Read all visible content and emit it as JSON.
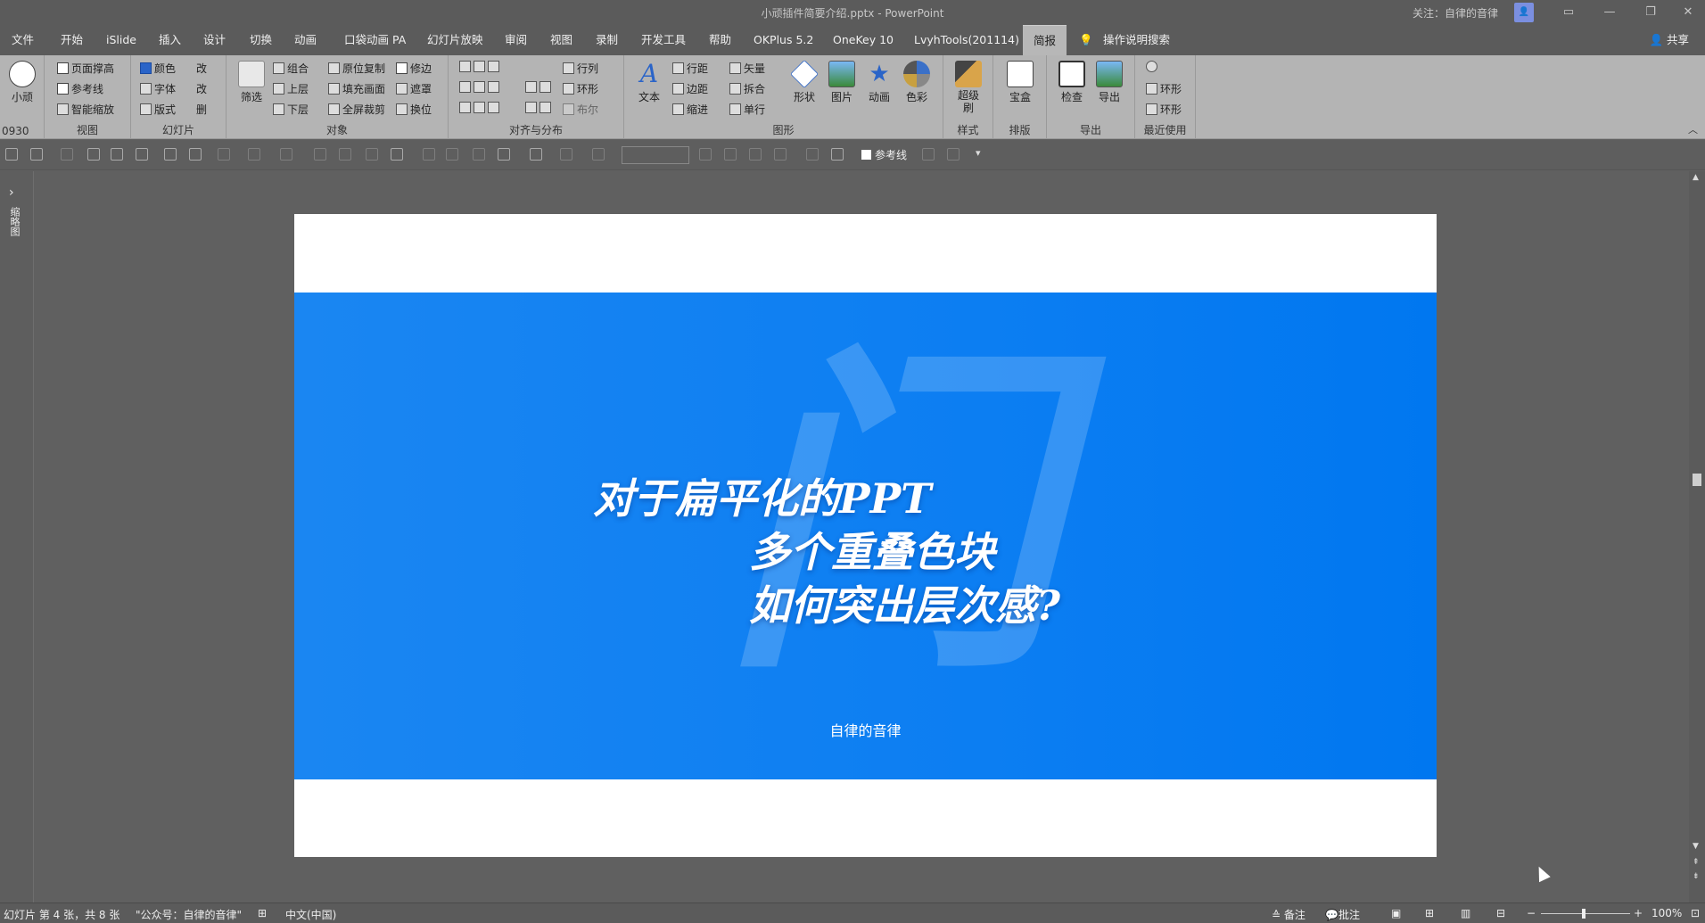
{
  "window": {
    "title": "小顽插件简要介绍.pptx  -  PowerPoint",
    "follow_text": "关注：自律的音律",
    "controls": [
      "▭",
      "—",
      "❐",
      "✕"
    ]
  },
  "tabs": [
    "文件",
    "开始",
    "iSlide",
    "插入",
    "设计",
    "切换",
    "动画",
    "口袋动画 PA",
    "幻灯片放映",
    "审阅",
    "视图",
    "录制",
    "开发工具",
    "帮助",
    "OKPlus 5.2",
    "OneKey 10",
    "LvyhTools(201114)",
    "简报"
  ],
  "tell_me": "操作说明搜索",
  "share": "共享",
  "ribbon": {
    "user": {
      "label": "小顽",
      "sub": "0930"
    },
    "view": {
      "items": [
        "页面撑高",
        "参考线",
        "智能缩放"
      ],
      "label": "视图"
    },
    "slide": {
      "items": [
        "颜色",
        "字体",
        "版式"
      ],
      "right": [
        "改",
        "改",
        "删"
      ],
      "label": "幻灯片"
    },
    "object": {
      "filter": "筛选",
      "col1": [
        "组合",
        "上层",
        "下层"
      ],
      "col2": [
        "原位复制",
        "填充画面",
        "全屏裁剪"
      ],
      "col3": [
        "修边",
        "遮罩",
        "换位"
      ],
      "label": "对象"
    },
    "align": {
      "items": [
        "行列",
        "环形",
        "布尔"
      ],
      "label": "对齐与分布"
    },
    "shape": {
      "text": "文本",
      "col1": [
        "行距",
        "边距",
        "缩进"
      ],
      "col2": [
        "矢量",
        "拆合",
        "单行"
      ],
      "big": [
        "形状",
        "图片",
        "动画",
        "色彩"
      ],
      "label": "图形"
    },
    "style": {
      "label": "样式",
      "btn": "超级刷"
    },
    "layout": {
      "label": "排版",
      "btn": "宝盒"
    },
    "export": {
      "label": "导出",
      "btns": [
        "检查",
        "导出"
      ]
    },
    "recent": {
      "label": "最近使用",
      "items": [
        "环形",
        "环形"
      ]
    }
  },
  "qat": {
    "refline": "参考线"
  },
  "leftpanel": {
    "label": "缩略图"
  },
  "slide": {
    "watermark": "门",
    "line1": "对于扁平化的PPT",
    "line2": "多个重叠色块",
    "line3": "如何突出层次感?",
    "author": "自律的音律",
    "colors": {
      "band": "#0c7ef2",
      "background": "#ffffff"
    }
  },
  "status": {
    "slide_info": "幻灯片 第 4 张，共 8 张",
    "theme": "\"公众号：自律的音律\"",
    "language": "中文(中国)",
    "notes": "备注",
    "comments": "批注",
    "zoom": "100%"
  }
}
